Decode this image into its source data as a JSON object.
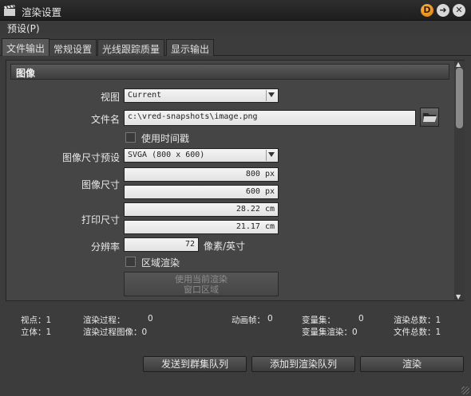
{
  "window": {
    "title": "渲染设置",
    "btn_d": "D",
    "btn_arrow": "➜",
    "btn_close": "✕"
  },
  "menu": {
    "preset": "预设(P)"
  },
  "tabs": [
    "文件输出",
    "常规设置",
    "光线跟踪质量",
    "显示输出"
  ],
  "section": {
    "title": "图像"
  },
  "form": {
    "view_label": "视图",
    "view_value": "Current",
    "filename_label": "文件名",
    "filename_value": "c:\\vred-snapshots\\image.png",
    "timestamp_label": "使用时间戳",
    "preset_label": "图像尺寸预设",
    "preset_value": "SVGA (800 x 600)",
    "size_label": "图像尺寸",
    "width_value": "800 px",
    "height_value": "600 px",
    "print_label": "打印尺寸",
    "print_w_value": "28.22 cm",
    "print_h_value": "21.17 cm",
    "dpi_label": "分辨率",
    "dpi_value": "72",
    "dpi_unit": "像素/英寸",
    "region_label": "区域渲染",
    "use_region_line1": "使用当前渲染",
    "use_region_line2": "窗口区域"
  },
  "stats": {
    "viewpoints": "视点：1",
    "stereo": "立体：1",
    "render_passes": "渲染过程：",
    "render_passes_val": "0",
    "pass_images": "渲染过程图像：0",
    "anim_frames": "动画帧：",
    "anim_frames_val": "0",
    "variant_sets": "变量集：",
    "variant_sets_val": "0",
    "variant_render": "变量集渲染：0",
    "total_renders": "渲染总数：1",
    "total_files": "文件总数：1"
  },
  "buttons": {
    "send_cluster": "发送到群集队列",
    "add_queue": "添加到渲染队列",
    "render": "渲染"
  }
}
